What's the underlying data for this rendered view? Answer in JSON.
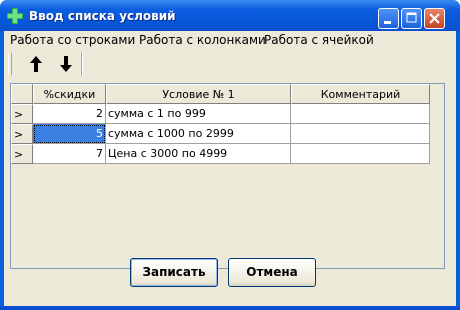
{
  "window": {
    "title": "Ввод списка условий"
  },
  "menu": [
    "Работа со строками",
    "Работа с колонками",
    "Работа с ячейкой"
  ],
  "toolbar": {
    "up_icon": "arrow-up-icon",
    "down_icon": "arrow-down-icon"
  },
  "grid": {
    "columns": [
      "%скидки",
      "Условие № 1",
      "Комментарий"
    ],
    "rows": [
      {
        "indicator": ">",
        "discount": "2",
        "condition": "сумма с 1 по 999",
        "comment": ""
      },
      {
        "indicator": ">",
        "discount": "5",
        "condition": "сумма с 1000 по 2999",
        "comment": ""
      },
      {
        "indicator": ">",
        "discount": "7",
        "condition": "Цена с 3000 по 4999",
        "comment": ""
      }
    ]
  },
  "buttons": {
    "save": "Записать",
    "cancel": "Отмена"
  },
  "colors": {
    "title_bar": "#0756d8",
    "selection": "#3a80e0",
    "face": "#ece9d8"
  }
}
